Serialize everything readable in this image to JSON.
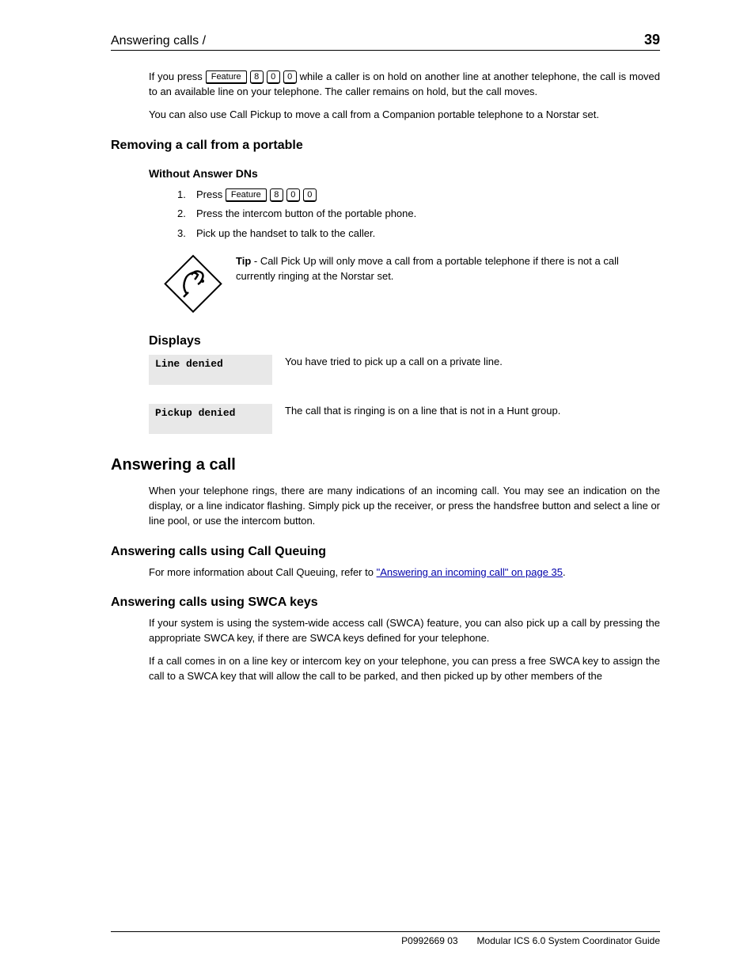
{
  "header": {
    "title": "Answering calls /",
    "page": "39"
  },
  "feature_key": "Feature",
  "digits": [
    "8",
    "0",
    "0"
  ],
  "intro": {
    "p1": "If you press  while a caller is on hold on another line at another telephone, the call is moved to an available line on your telephone. The caller remains on hold, but the call moves.",
    "p2": "You can also use Call Pickup to move a call from a Companion portable telephone to a Norstar set."
  },
  "section1": {
    "heading": "Removing a call from a portable",
    "sub": "Without Answer DNs",
    "steps": [
      "Press ",
      "Press the intercom button of the portable phone.",
      "Pick up the handset to talk to the caller."
    ]
  },
  "tip": {
    "title": "Tip",
    "body": " -  Call Pick Up will only move a call from a portable telephone if there is not a call currently ringing at the Norstar set."
  },
  "section2": {
    "heading": "Displays",
    "rows": [
      {
        "screen": "Line denied",
        "desc": "You have tried to pick up a call on a private line."
      },
      {
        "screen": "Pickup denied",
        "desc": "The call that is ringing is on a line that is not in a Hunt group."
      }
    ]
  },
  "h2_answer": "Answering a call",
  "answer_p": "When your telephone rings, there are many indications of an incoming call. You may see an indication on the display, or a line indicator flashing. Simply pick up the receiver, or press the handsfree button and select a line or line pool, or use the intercom button.",
  "h3_callqueue": "Answering calls using Call Queuing",
  "callqueue_p1_before": "For more information about Call Queuing, refer to ",
  "callqueue_link": "\"Answering an incoming call\" on page 35",
  "callqueue_p1_after": ".",
  "h3_swca": "Answering calls using SWCA keys",
  "swca_p1": "If your system is using the system-wide access call (SWCA) feature, you can also pick up a call by pressing the appropriate SWCA key, if there are SWCA keys defined for your telephone.",
  "swca_p2": "If a call comes in on a line key or intercom key on your telephone, you can press a free SWCA key to assign the call to a SWCA key that will allow the call to be parked, and then picked up by other members of the",
  "footer": {
    "left": "P0992669 03",
    "right": "Modular ICS 6.0 System Coordinator Guide"
  }
}
